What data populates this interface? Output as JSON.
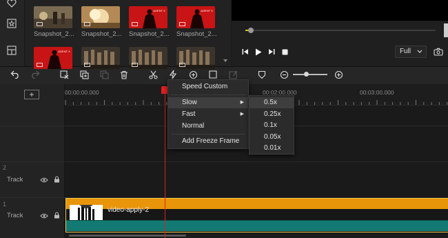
{
  "media": {
    "items": [
      {
        "label": "Snapshot_2...",
        "kind": "battle"
      },
      {
        "label": "Snapshot_2...",
        "kind": "explosion"
      },
      {
        "label": "Snapshot_2...",
        "kind": "agent",
        "badge": "AGENT X"
      },
      {
        "label": "Snapshot_2...",
        "kind": "agent",
        "badge": "AGENT X"
      },
      {
        "kind": "agent",
        "badge": "AGENT X"
      },
      {
        "kind": "crowd"
      },
      {
        "kind": "crowd"
      },
      {
        "kind": "crowd"
      }
    ]
  },
  "preview": {
    "quality": "Full"
  },
  "timeline": {
    "add_track": "+",
    "ruler": [
      "00:00:00.000",
      "00:02:00.000",
      "00:03:00.000"
    ],
    "tracks": [
      {
        "number": "2",
        "label": "Track"
      },
      {
        "number": "1",
        "label": "Track"
      }
    ],
    "clip_name": "video-apply-2"
  },
  "context_menu": {
    "items": [
      {
        "label": "Speed Custom"
      },
      {
        "label": "Slow",
        "has_submenu": true
      },
      {
        "label": "Fast",
        "has_submenu": true
      },
      {
        "label": "Normal"
      },
      {
        "label": "Add Freeze Frame"
      }
    ],
    "submenu": [
      "0.5x",
      "0.25x",
      "0.1x",
      "0.05x",
      "0.01x"
    ],
    "submenu_arrow": "▶"
  },
  "colors": {
    "accent_orange": "#e8950a",
    "playhead": "#e02020",
    "clip_teal": "#137a73",
    "agent_red": "#c81414",
    "progress_yellow": "#e6c200"
  },
  "icons": [
    "heart-icon",
    "favorite-star-icon",
    "layout-icon",
    "step-back-icon",
    "play-icon",
    "step-forward-icon",
    "stop-icon",
    "camera-icon",
    "undo-icon",
    "redo-icon",
    "delete-clip-icon",
    "copy-icon",
    "paste-icon",
    "trash-icon",
    "cut-icon",
    "speed-icon",
    "add-marker-icon",
    "crop-icon",
    "edit-icon",
    "shield-icon",
    "zoom-out-icon",
    "zoom-in-icon",
    "eye-icon",
    "lock-icon"
  ]
}
